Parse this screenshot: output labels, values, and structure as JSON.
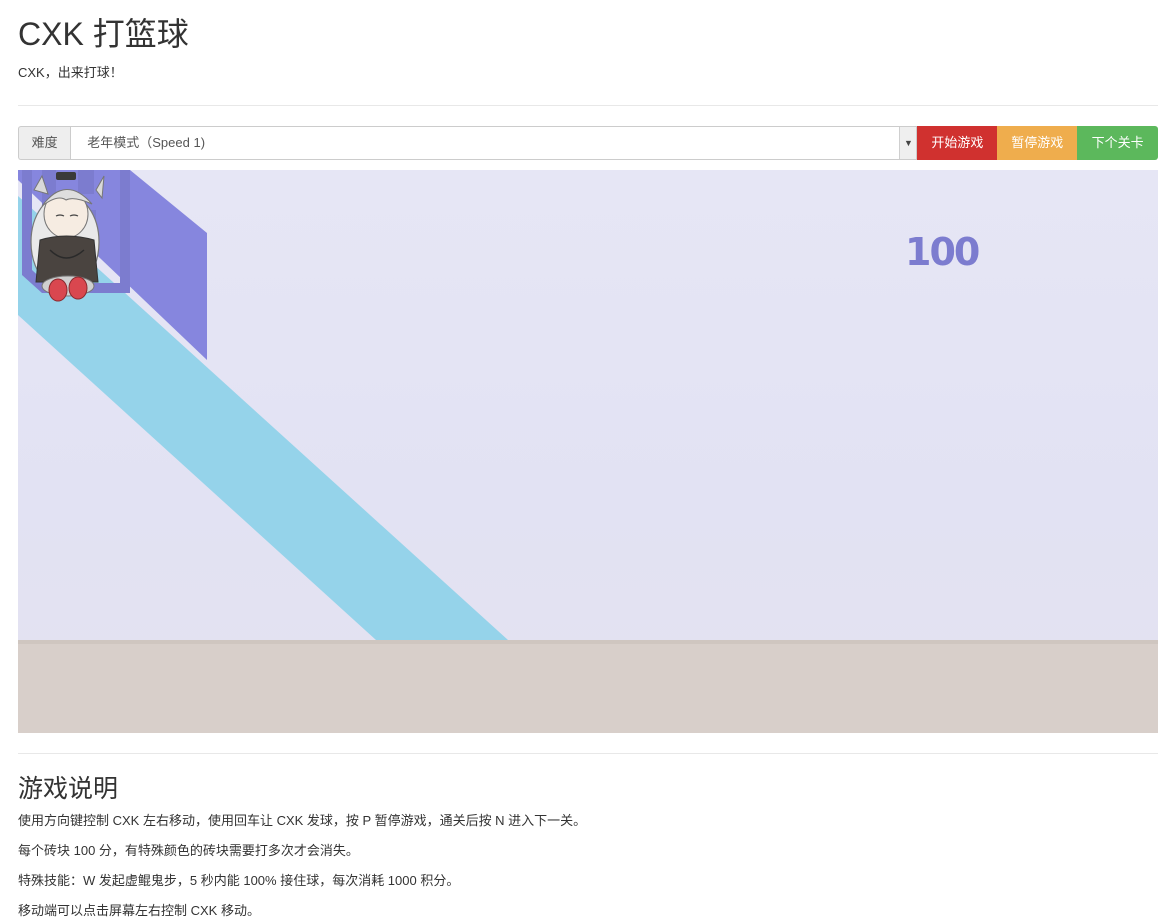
{
  "header": {
    "title": "CXK 打篮球",
    "subtitle": "CXK，出来打球！"
  },
  "controls": {
    "difficulty_label": "难度",
    "difficulty_selected": "老年模式（Speed 1)",
    "start_label": "开始游戏",
    "pause_label": "暂停游戏",
    "next_label": "下个关卡"
  },
  "game": {
    "score_text": "100",
    "background_icons": [
      "stage-logo-icon",
      "player-sprite-icon"
    ],
    "colors": {
      "stripe_purple": "#8686de",
      "stripe_cyan": "#95d3ea",
      "floor": "#d8cfca",
      "logo": "#7c7ccf"
    }
  },
  "instructions": {
    "title": "游戏说明",
    "rules": [
      "使用方向键控制 CXK 左右移动，使用回车让 CXK 发球，按 P 暂停游戏，通关后按 N 进入下一关。",
      "每个砖块 100 分，有特殊颜色的砖块需要打多次才会消失。",
      "特殊技能：W 发起虚鲲鬼步，5 秒内能 100% 接住球，每次消耗 1000 积分。",
      "移动端可以点击屏幕左右控制 CXK 移动。"
    ]
  },
  "theme": {
    "start_button_color": "#d0312f",
    "pause_button_color": "#efad4d",
    "next_button_color": "#5cb85c"
  }
}
